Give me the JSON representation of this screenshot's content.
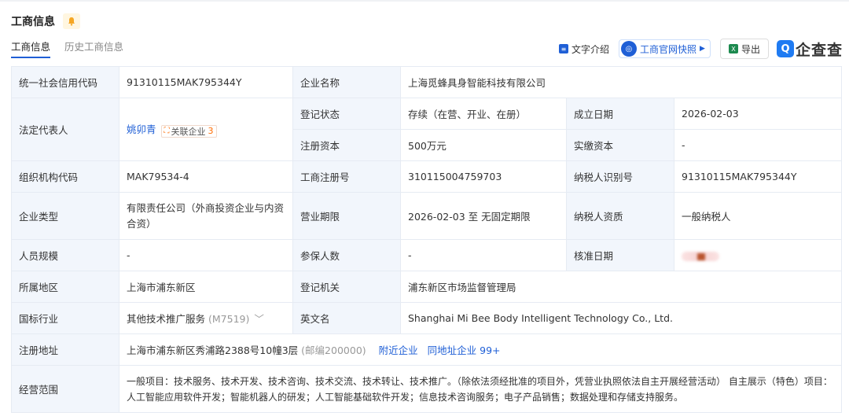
{
  "header": {
    "title": "工商信息"
  },
  "tabs": [
    {
      "label": "工商信息"
    },
    {
      "label": "历史工商信息"
    }
  ],
  "toolbar": {
    "text_intro": "文字介绍",
    "gov_snapshot": "工商官网快照",
    "export": "导出",
    "brand": "企查查"
  },
  "colors": {
    "accent": "#1f5fd6",
    "label_bg": "#f2f6fc",
    "border": "#e6ebf3",
    "tag_orange": "#ff6b00"
  },
  "icons": [
    "bell-icon",
    "doc-icon",
    "snapshot-icon",
    "excel-icon",
    "qcc-logo-icon",
    "chevron-down-icon",
    "related-company-icon",
    "lock-icon"
  ],
  "info": {
    "credit_code_label": "统一社会信用代码",
    "credit_code": "91310115MAK795344Y",
    "company_name_label": "企业名称",
    "company_name": "上海觅蜂具身智能科技有限公司",
    "legal_rep_label": "法定代表人",
    "legal_rep": "姚卯青",
    "related_label": "关联企业",
    "related_count": "3",
    "reg_status_label": "登记状态",
    "reg_status": "存续（在营、开业、在册）",
    "found_date_label": "成立日期",
    "found_date": "2026-02-03",
    "reg_capital_label": "注册资本",
    "reg_capital": "500万元",
    "paid_capital_label": "实缴资本",
    "paid_capital": "-",
    "org_code_label": "组织机构代码",
    "org_code": "MAK79534-4",
    "biz_reg_no_label": "工商注册号",
    "biz_reg_no": "310115004759703",
    "taxpayer_id_label": "纳税人识别号",
    "taxpayer_id": "91310115MAK795344Y",
    "company_type_label": "企业类型",
    "company_type": "有限责任公司（外商投资企业与内资合资）",
    "biz_term_label": "营业期限",
    "biz_term": "2026-02-03 至 无固定期限",
    "taxpayer_qual_label": "纳税人资质",
    "taxpayer_qual": "一般纳税人",
    "staff_size_label": "人员规模",
    "staff_size": "-",
    "insured_label": "参保人数",
    "insured": "-",
    "approve_date_label": "核准日期",
    "region_label": "所属地区",
    "region": "上海市浦东新区",
    "reg_authority_label": "登记机关",
    "reg_authority": "浦东新区市场监督管理局",
    "industry_label": "国标行业",
    "industry": "其他技术推广服务",
    "industry_code": "(M7519)",
    "english_name_label": "英文名",
    "english_name": "Shanghai Mi Bee Body Intelligent Technology Co., Ltd.",
    "address_label": "注册地址",
    "address": "上海市浦东新区秀浦路2388号10幢3层",
    "postcode": "(邮编200000)",
    "nearby": "附近企业",
    "same_address": "同地址企业 99+",
    "scope_label": "经营范围",
    "scope": "一般项目：技术服务、技术开发、技术咨询、技术交流、技术转让、技术推广。（除依法须经批准的项目外，凭营业执照依法自主开展经营活动） 自主展示（特色）项目：人工智能应用软件开发；智能机器人的研发；人工智能基础软件开发；信息技术咨询服务；电子产品销售；数据处理和存储支持服务。"
  }
}
